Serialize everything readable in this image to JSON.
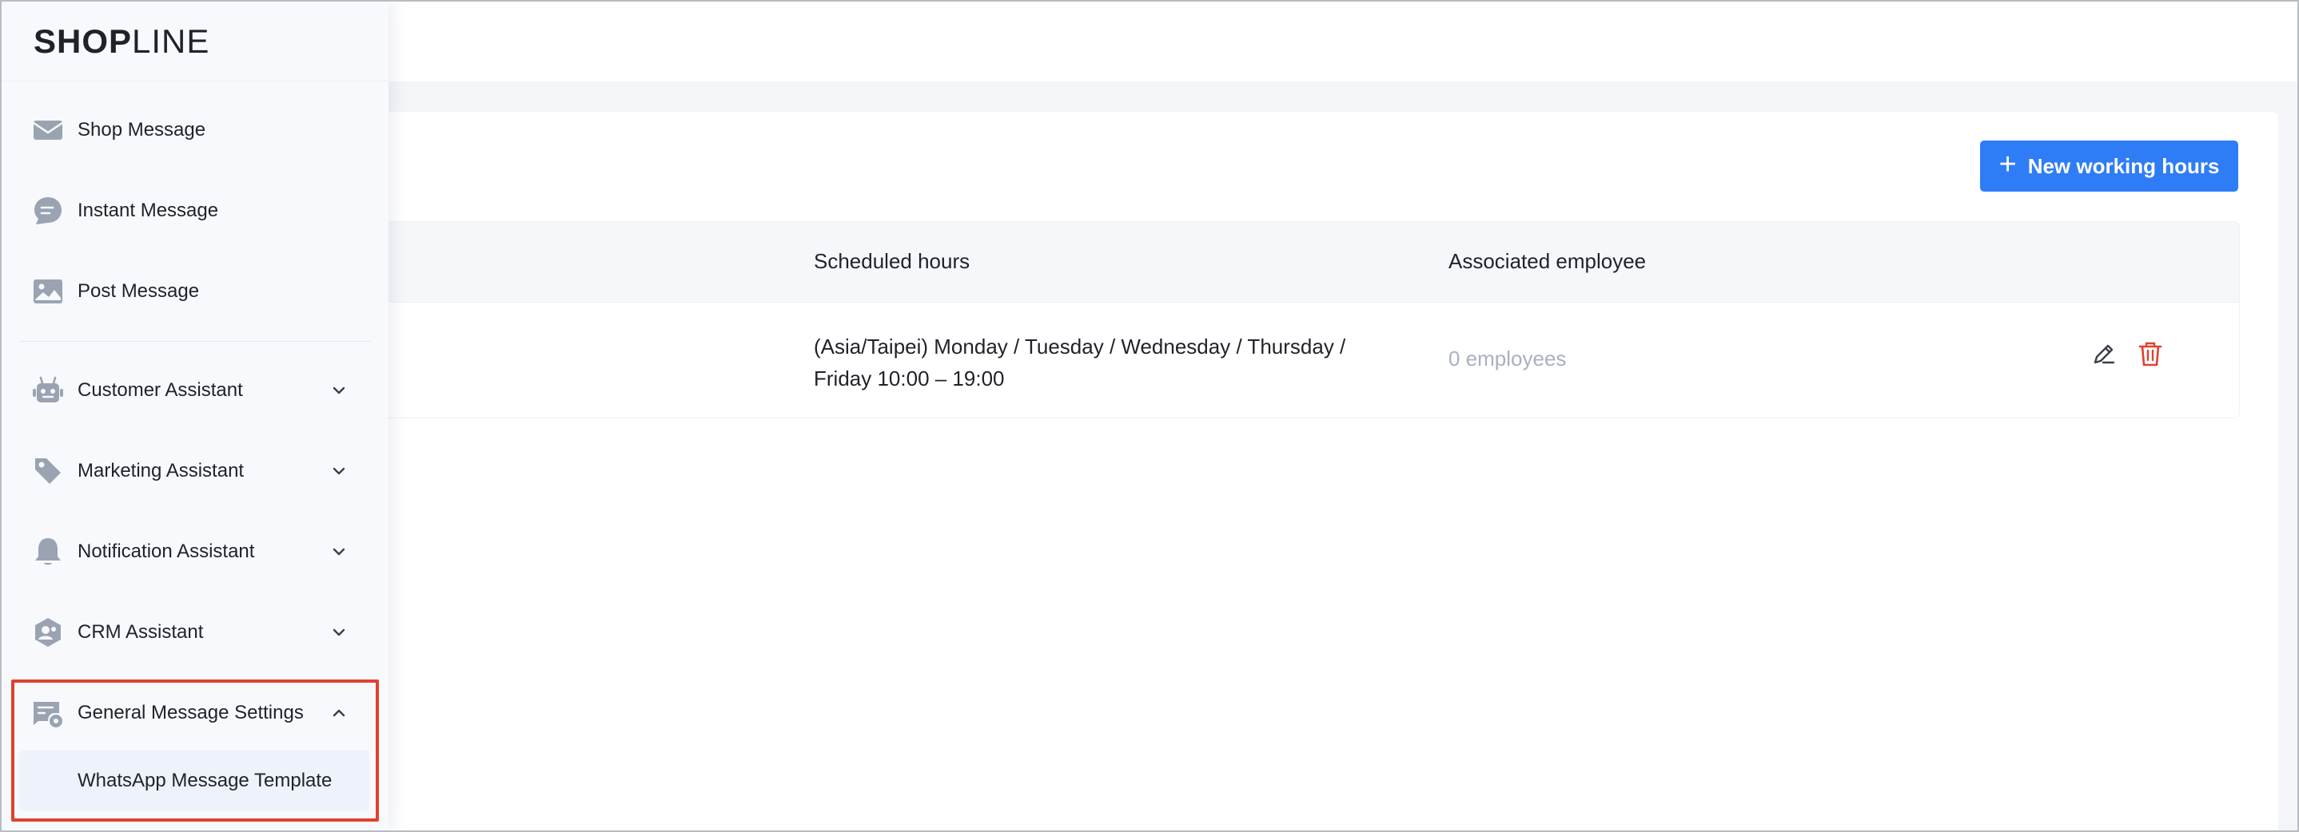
{
  "brand": {
    "logo_part1": "SHOP",
    "logo_part2": "LINE"
  },
  "sidebar": {
    "items": [
      {
        "label": "Shop Message",
        "icon": "envelope-icon"
      },
      {
        "label": "Instant Message",
        "icon": "chat-bubble-icon"
      },
      {
        "label": "Post Message",
        "icon": "image-icon"
      },
      {
        "label": "Customer Assistant",
        "icon": "robot-icon"
      },
      {
        "label": "Marketing Assistant",
        "icon": "tag-icon"
      },
      {
        "label": "Notification Assistant",
        "icon": "bell-icon"
      },
      {
        "label": "CRM Assistant",
        "icon": "users-badge-icon"
      },
      {
        "label": "General Message Settings",
        "icon": "message-settings-icon"
      }
    ],
    "sub_item": {
      "label": "WhatsApp Message Template"
    }
  },
  "toolbar": {
    "new_button_label": "New working hours"
  },
  "table": {
    "columns": [
      "Scheduled hours",
      "Associated employee"
    ],
    "rows": [
      {
        "scheduled_line1": "(Asia/Taipei) Monday / Tuesday / Wednesday / Thursday /",
        "scheduled_line2": "Friday 10:00 – 19:00",
        "employees": "0 employees"
      }
    ]
  },
  "colors": {
    "primary": "#2f7df6",
    "danger": "#e1402f",
    "muted_text": "#a8b1bf"
  }
}
